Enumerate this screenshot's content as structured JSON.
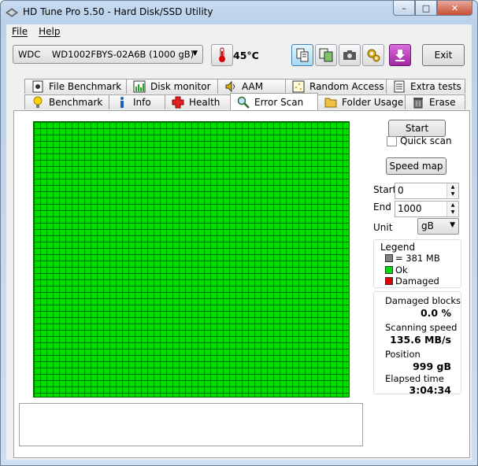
{
  "window": {
    "title": "HD Tune Pro 5.50 - Hard Disk/SSD Utility",
    "minimize": "–",
    "maximize": "□",
    "close": "✕"
  },
  "menu": {
    "file": "File",
    "help": "Help"
  },
  "toolbar": {
    "drive": "WDC    WD1002FBYS-02A6B (1000 gB)",
    "temperature": "45°C",
    "exit_label": "Exit"
  },
  "tabs_back": [
    {
      "label": "File Benchmark",
      "icon": "file-benchmark-icon"
    },
    {
      "label": "Disk monitor",
      "icon": "disk-monitor-icon"
    },
    {
      "label": "AAM",
      "icon": "speaker-icon"
    },
    {
      "label": "Random Access",
      "icon": "random-access-icon"
    },
    {
      "label": "Extra tests",
      "icon": "extra-tests-icon"
    }
  ],
  "tabs_front": [
    {
      "label": "Benchmark",
      "icon": "lightbulb-icon"
    },
    {
      "label": "Info",
      "icon": "info-icon"
    },
    {
      "label": "Health",
      "icon": "health-cross-icon"
    },
    {
      "label": "Error Scan",
      "icon": "magnifier-icon",
      "selected": true
    },
    {
      "label": "Folder Usage",
      "icon": "folder-icon"
    },
    {
      "label": "Erase",
      "icon": "trash-icon"
    }
  ],
  "scan": {
    "start_button": "Start",
    "quick_scan_label": "Quick scan",
    "quick_scan_checked": false,
    "speed_map_button": "Speed map",
    "start_label": "Start",
    "start_value": "0",
    "end_label": "End",
    "end_value": "1000",
    "unit_label": "Unit",
    "unit_value": "gB"
  },
  "legend": {
    "title": "Legend",
    "block": "= 381 MB",
    "ok": "Ok",
    "damaged": "Damaged",
    "colors": {
      "block": "#808080",
      "ok": "#00dc00",
      "damaged": "#e00000"
    }
  },
  "stats": {
    "damaged_label": "Damaged blocks",
    "damaged_value": "0.0 %",
    "speed_label": "Scanning speed",
    "speed_value": "135.6 MB/s",
    "position_label": "Position",
    "position_value": "999 gB",
    "elapsed_label": "Elapsed time",
    "elapsed_value": "3:04:34"
  },
  "grid": {
    "ok_color": "#00dc00",
    "line_color": "#007000"
  }
}
